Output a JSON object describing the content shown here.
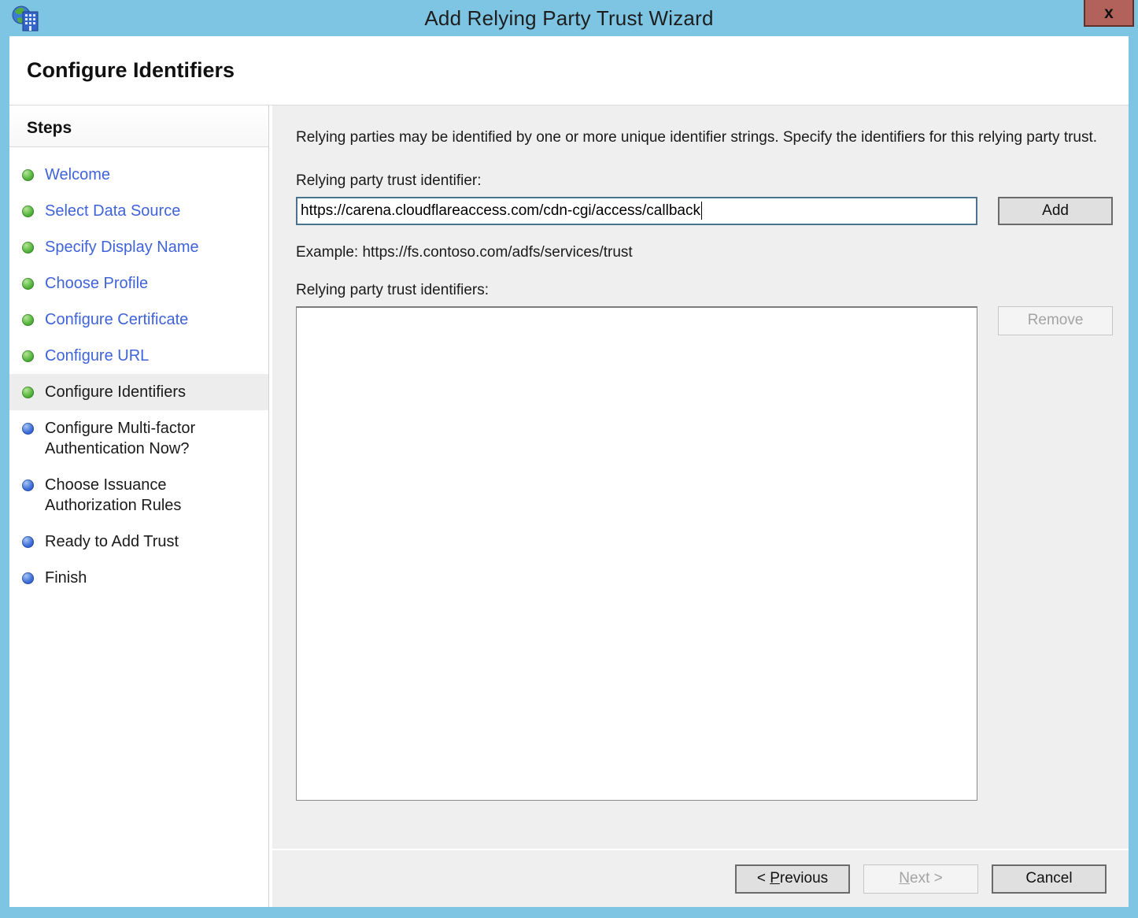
{
  "window": {
    "title": "Add Relying Party Trust Wizard",
    "close_glyph": "x",
    "app_icon": "adfs-globe-building-icon"
  },
  "header": {
    "title": "Configure Identifiers"
  },
  "sidebar": {
    "title": "Steps",
    "steps": [
      {
        "label": "Welcome",
        "state": "done"
      },
      {
        "label": "Select Data Source",
        "state": "done"
      },
      {
        "label": "Specify Display Name",
        "state": "done"
      },
      {
        "label": "Choose Profile",
        "state": "done"
      },
      {
        "label": "Configure Certificate",
        "state": "done"
      },
      {
        "label": "Configure URL",
        "state": "done"
      },
      {
        "label": "Configure Identifiers",
        "state": "current"
      },
      {
        "label": "Configure Multi-factor Authentication Now?",
        "state": "upcoming"
      },
      {
        "label": "Choose Issuance Authorization Rules",
        "state": "upcoming"
      },
      {
        "label": "Ready to Add Trust",
        "state": "upcoming"
      },
      {
        "label": "Finish",
        "state": "upcoming"
      }
    ]
  },
  "main": {
    "intro": "Relying parties may be identified by one or more unique identifier strings. Specify the identifiers for this relying party trust.",
    "identifier_label": "Relying party trust identifier:",
    "identifier_value": "https://carena.cloudflareaccess.com/cdn-cgi/access/callback",
    "add_button": "Add",
    "example": "Example: https://fs.contoso.com/adfs/services/trust",
    "identifiers_list_label": "Relying party trust identifiers:",
    "identifiers_list_items": [],
    "remove_button": "Remove",
    "remove_disabled": true
  },
  "footer": {
    "previous_button": {
      "prefix": "< ",
      "access_key": "P",
      "rest": "revious"
    },
    "next_button": {
      "prefix": "",
      "access_key": "N",
      "rest": "ext >"
    },
    "next_disabled": true,
    "cancel_button": "Cancel"
  },
  "colors": {
    "titlebar_and_frame": "#7dc5e3",
    "close_button_fill": "#b2625b",
    "close_button_border": "#5f2f28",
    "step_link_blue": "#3f63d9",
    "bullet_green": "#55b53e",
    "bullet_blue": "#3e6ed6",
    "current_step_highlight": "#ededed",
    "content_background": "#efefef",
    "focused_input_border": "#4a7390",
    "button_face": "#e0e0e0",
    "button_border": "#6b6b6b",
    "disabled_text": "#a3a3a3"
  }
}
